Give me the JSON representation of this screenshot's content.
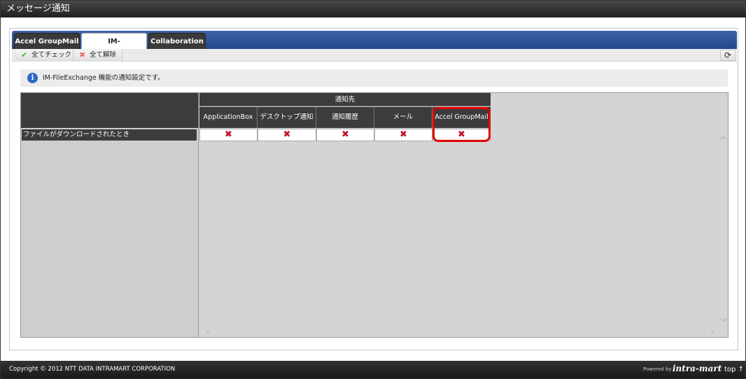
{
  "window": {
    "title": "メッセージ通知"
  },
  "tabs": [
    {
      "label": "Accel GroupMail"
    },
    {
      "label": "IM-FileExchange"
    },
    {
      "label": "Collaboration"
    }
  ],
  "toolbar": {
    "check_all_label": "全てチェック",
    "uncheck_all_label": "全て解除",
    "check_icon": "✔",
    "uncheck_icon": "✖",
    "refresh_icon": "⟳"
  },
  "info": {
    "icon": "i",
    "text": "IM-FileExchange 機能の通知設定です。"
  },
  "grid": {
    "group_label": "通知先",
    "columns": [
      "ApplicationBox",
      "デスクトップ通知",
      "通知履歴",
      "メール",
      "Accel GroupMail"
    ],
    "rows": [
      {
        "label": "ファイルがダウンロードされたとき",
        "cells": [
          "✖",
          "✖",
          "✖",
          "✖",
          "✖"
        ]
      }
    ],
    "highlight_color": "#e00000"
  },
  "footer": {
    "copyright": "Copyright © 2012 NTT DATA INTRAMART CORPORATION",
    "powered_by": "Powered by",
    "logo": "intra-mart",
    "top_link": "top ↑"
  }
}
